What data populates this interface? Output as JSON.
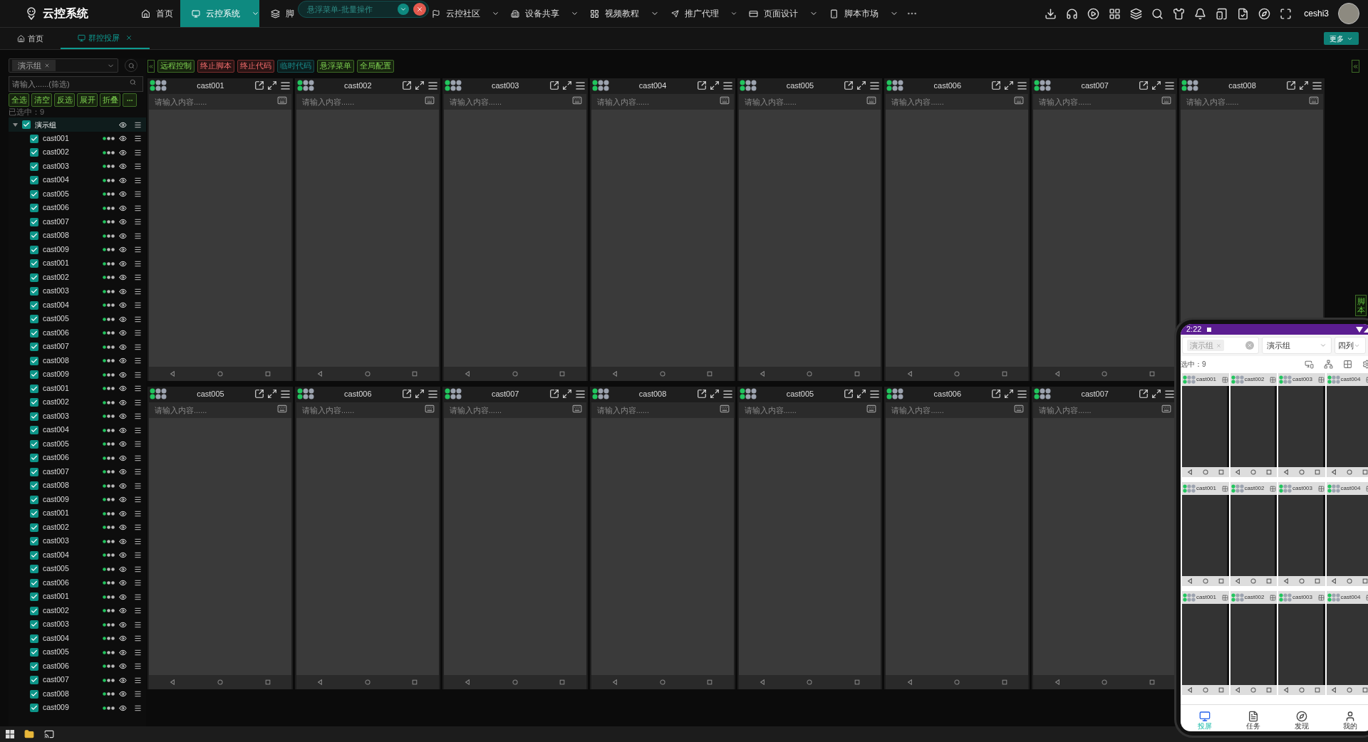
{
  "nav": {
    "logo": "云控系统",
    "items": [
      {
        "label": "首页",
        "selected": false,
        "dropdown": false
      },
      {
        "label": "云控系统",
        "selected": true,
        "dropdown": true
      },
      {
        "label": "脚",
        "selected": false,
        "dropdown": false
      },
      {
        "label": "云控社区",
        "selected": false,
        "dropdown": true
      },
      {
        "label": "设备共享",
        "selected": false,
        "dropdown": true
      },
      {
        "label": "视频教程",
        "selected": false,
        "dropdown": true
      },
      {
        "label": "推广代理",
        "selected": false,
        "dropdown": true
      },
      {
        "label": "页面设计",
        "selected": false,
        "dropdown": true
      },
      {
        "label": "脚本市场",
        "selected": false,
        "dropdown": true
      }
    ],
    "user": "ceshi3"
  },
  "float_menu": {
    "label": "悬浮菜单-批量操作"
  },
  "tabs": [
    {
      "label": "首页",
      "selected": false,
      "closable": false
    },
    {
      "label": "群控投屏",
      "selected": true,
      "closable": true
    }
  ],
  "more_button": "更多",
  "sidebar": {
    "group_chip": "演示组",
    "filter_placeholder": "请输入......(筛选)",
    "buttons": [
      "全选",
      "清空",
      "反选",
      "展开",
      "折叠"
    ],
    "selected_count": "已选中：9",
    "tree": {
      "label": "演示组",
      "checked": true,
      "expanded": true,
      "children": [
        {
          "label": "cast001",
          "checked": true
        },
        {
          "label": "cast002",
          "checked": true
        },
        {
          "label": "cast003",
          "checked": true
        },
        {
          "label": "cast004",
          "checked": true
        },
        {
          "label": "cast005",
          "checked": true
        },
        {
          "label": "cast006",
          "checked": true
        },
        {
          "label": "cast007",
          "checked": true
        },
        {
          "label": "cast008",
          "checked": true
        },
        {
          "label": "cast009",
          "checked": true
        },
        {
          "label": "cast001",
          "checked": true
        },
        {
          "label": "cast002",
          "checked": true
        },
        {
          "label": "cast003",
          "checked": true
        },
        {
          "label": "cast004",
          "checked": true
        },
        {
          "label": "cast005",
          "checked": true
        },
        {
          "label": "cast006",
          "checked": true
        },
        {
          "label": "cast007",
          "checked": true
        },
        {
          "label": "cast008",
          "checked": true
        },
        {
          "label": "cast009",
          "checked": true
        },
        {
          "label": "cast001",
          "checked": true
        },
        {
          "label": "cast002",
          "checked": true
        },
        {
          "label": "cast003",
          "checked": true
        },
        {
          "label": "cast004",
          "checked": true
        },
        {
          "label": "cast005",
          "checked": true
        },
        {
          "label": "cast006",
          "checked": true
        },
        {
          "label": "cast007",
          "checked": true
        },
        {
          "label": "cast008",
          "checked": true
        },
        {
          "label": "cast009",
          "checked": true
        },
        {
          "label": "cast001",
          "checked": true
        },
        {
          "label": "cast002",
          "checked": true
        },
        {
          "label": "cast003",
          "checked": true
        },
        {
          "label": "cast004",
          "checked": true
        },
        {
          "label": "cast005",
          "checked": true
        },
        {
          "label": "cast006",
          "checked": true
        },
        {
          "label": "cast001",
          "checked": true
        },
        {
          "label": "cast002",
          "checked": true
        },
        {
          "label": "cast003",
          "checked": true
        },
        {
          "label": "cast004",
          "checked": true
        },
        {
          "label": "cast005",
          "checked": true
        },
        {
          "label": "cast006",
          "checked": true
        },
        {
          "label": "cast007",
          "checked": true
        },
        {
          "label": "cast008",
          "checked": true
        },
        {
          "label": "cast009",
          "checked": true
        }
      ]
    }
  },
  "toolbar": [
    {
      "label": "远程控制",
      "kind": "normal"
    },
    {
      "label": "终止脚本",
      "kind": "danger"
    },
    {
      "label": "终止代码",
      "kind": "danger"
    },
    {
      "label": "临时代码",
      "kind": "info"
    },
    {
      "label": "悬浮菜单",
      "kind": "normal"
    },
    {
      "label": "全局配置",
      "kind": "normal"
    }
  ],
  "devices": [
    {
      "name": "cast001",
      "placeholder": "请输入内容......"
    },
    {
      "name": "cast002",
      "placeholder": "请输入内容......"
    },
    {
      "name": "cast003",
      "placeholder": "请输入内容......"
    },
    {
      "name": "cast004",
      "placeholder": "请输入内容......"
    },
    {
      "name": "cast005",
      "placeholder": "请输入内容......"
    },
    {
      "name": "cast006",
      "placeholder": "请输入内容......"
    },
    {
      "name": "cast007",
      "placeholder": "请输入内容......"
    },
    {
      "name": "cast008",
      "placeholder": "请输入内容......"
    },
    {
      "name": "cast005",
      "placeholder": "请输入内容......"
    },
    {
      "name": "cast006",
      "placeholder": "请输入内容......"
    },
    {
      "name": "cast007",
      "placeholder": "请输入内容......"
    },
    {
      "name": "cast008",
      "placeholder": "请输入内容......"
    },
    {
      "name": "cast005",
      "placeholder": "请输入内容......"
    },
    {
      "name": "cast006",
      "placeholder": "请输入内容......"
    },
    {
      "name": "cast007",
      "placeholder": "请输入内容......"
    }
  ],
  "side_tab": "脚本",
  "phone": {
    "time": "2:22",
    "chip": "演示组",
    "group_select": "演示组",
    "columns_select": "四列",
    "selected_count": "选中：9",
    "rows": [
      [
        "cast001",
        "cast002",
        "cast003",
        "cast004"
      ],
      [
        "cast001",
        "cast002",
        "cast003",
        "cast004"
      ],
      [
        "cast001",
        "cast002",
        "cast003",
        "cast004"
      ]
    ],
    "tabs": [
      {
        "label": "投屏",
        "selected": true
      },
      {
        "label": "任务",
        "selected": false
      },
      {
        "label": "发现",
        "selected": false
      },
      {
        "label": "我的",
        "selected": false
      }
    ]
  }
}
